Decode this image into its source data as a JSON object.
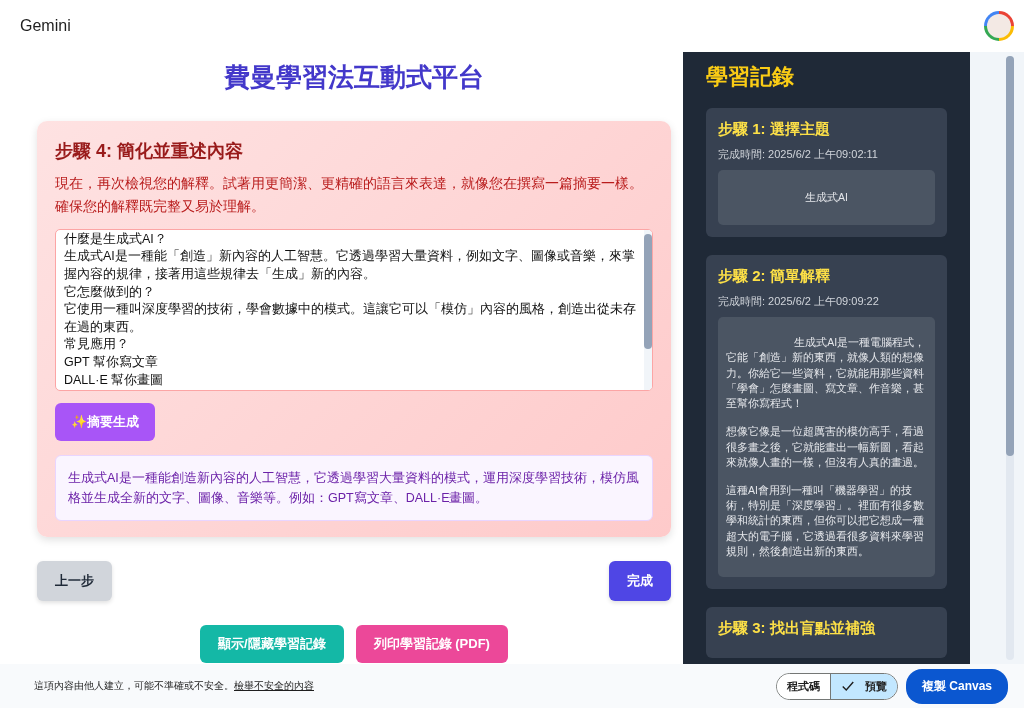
{
  "header": {
    "app_name": "Gemini"
  },
  "main": {
    "title": "費曼學習法互動式平台",
    "step_card": {
      "title": "步驟 4: 簡化並重述內容",
      "instruction": "現在，再次檢視您的解釋。試著用更簡潔、更精確的語言來表達，就像您在撰寫一篇摘要一樣。確保您的解釋既完整又易於理解。",
      "answer_lines": [
        "什麼是生成式AI？",
        "生成式AI是一種能「創造」新內容的人工智慧。它透過學習大量資料，例如文字、圖像或音樂，來掌握內容的規律，接著用這些規律去「生成」新的內容。",
        "它怎麼做到的？",
        "它使用一種叫深度學習的技術，學會數據中的模式。這讓它可以「模仿」內容的風格，創造出從未存在過的東西。",
        "常見應用？",
        "GPT 幫你寫文章",
        "DALL·E 幫你畫圖"
      ],
      "generate_button": "✨摘要生成",
      "summary": "生成式AI是一種能創造新內容的人工智慧，它透過學習大量資料的模式，運用深度學習技術，模仿風格並生成全新的文字、圖像、音樂等。例如：GPT寫文章、DALL·E畫圖。"
    },
    "prev_button": "上一步",
    "finish_button": "完成",
    "toggle_log_button": "顯示/隱藏學習記錄",
    "print_button": "列印學習記錄 (PDF)"
  },
  "log_panel": {
    "title": "學習記錄",
    "entries": [
      {
        "title": "步驟 1: 選擇主題",
        "time": "完成時間: 2025/6/2 上午09:02:11",
        "kind": "centered",
        "paragraphs": [
          "生成式AI"
        ]
      },
      {
        "title": "步驟 2: 簡單解釋",
        "time": "完成時間: 2025/6/2 上午09:09:22",
        "kind": "indented",
        "paragraphs": [
          "生成式AI是一種電腦程式，它能「創造」新的東西，就像人類的想像力。你給它一些資料，它就能用那些資料「學會」怎麼畫圖、寫文章、作音樂，甚至幫你寫程式！",
          "想像它像是一位超厲害的模仿高手，看過很多畫之後，它就能畫出一幅新圖，看起來就像人畫的一樣，但沒有人真的畫過。",
          "這種AI會用到一種叫「機器學習」的技術，特別是「深度學習」。裡面有很多數學和統計的東西，但你可以把它想成一種超大的電子腦，它透過看很多資料來學習規則，然後創造出新的東西。"
        ]
      },
      {
        "title": "步驟 3: 找出盲點並補強"
      }
    ]
  },
  "footer": {
    "notice": "這項內容由他人建立，可能不準確或不安全。",
    "report_link": "檢舉不安全的內容",
    "view_toggle": [
      {
        "label": "程式碼",
        "selected": false
      },
      {
        "label": "預覽",
        "selected": true
      }
    ],
    "copy_button": "複製 Canvas"
  }
}
